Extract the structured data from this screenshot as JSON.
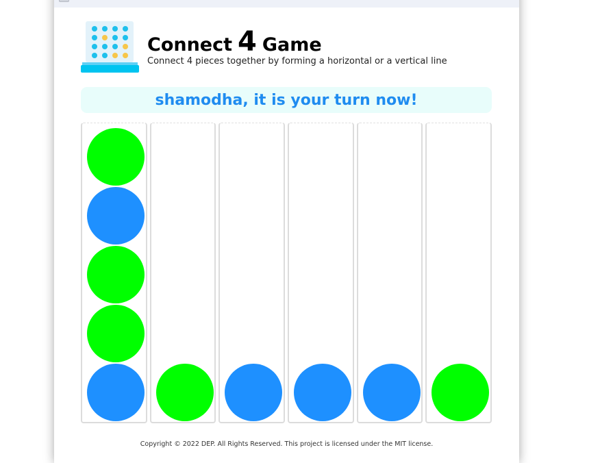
{
  "window": {
    "title": ""
  },
  "header": {
    "title_prefix": "Connect",
    "title_number": "4",
    "title_suffix": "Game",
    "subtitle": "Connect 4 pieces together by forming a horizontal or a vertical line"
  },
  "status": {
    "turn_message": "shamodha, it is your turn now!"
  },
  "board": {
    "columns": 6,
    "rows": 5,
    "colors": {
      "green": "#00ff00",
      "blue": "#1e90ff"
    },
    "pieces": [
      [
        "green",
        "blue",
        "green",
        "green",
        "blue"
      ],
      [
        null,
        null,
        null,
        null,
        "green"
      ],
      [
        null,
        null,
        null,
        null,
        "blue"
      ],
      [
        null,
        null,
        null,
        null,
        "blue"
      ],
      [
        null,
        null,
        null,
        null,
        "blue"
      ],
      [
        null,
        null,
        null,
        null,
        "green"
      ]
    ]
  },
  "footer": {
    "copyright": "Copyright © 2022 DEP. All Rights Reserved. This project is licensed under the MIT license."
  },
  "icons": {
    "logo": "connect-four-grid-icon"
  },
  "accent_color": "#1f8cf0"
}
